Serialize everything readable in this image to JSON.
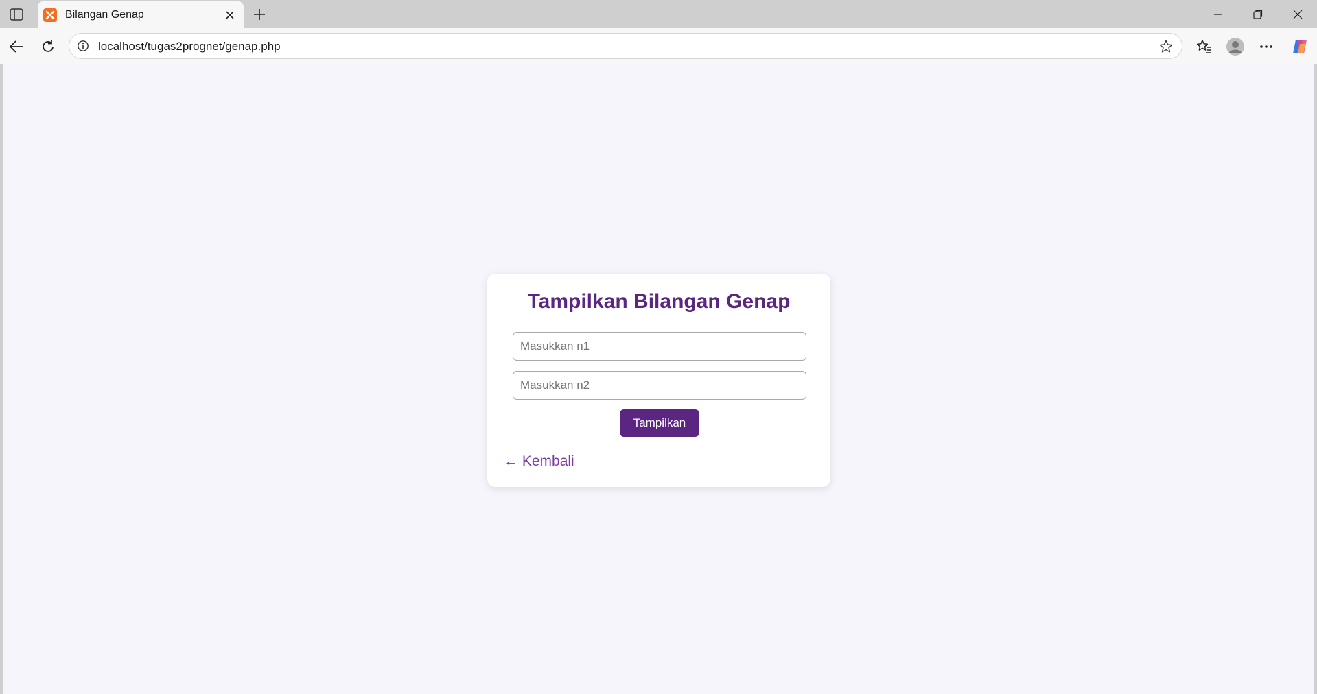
{
  "browser": {
    "tab_title": "Bilangan Genap",
    "url": "localhost/tugas2prognet/genap.php",
    "icons": {
      "sidebar": "sidebar-toggle-icon",
      "favicon": "xampp-icon",
      "tab_close": "close-icon",
      "new_tab": "plus-icon",
      "back": "arrow-left-icon",
      "reload": "reload-icon",
      "site_info": "info-icon",
      "favorite": "star-icon",
      "favorites": "favorites-icon",
      "profile": "profile-icon",
      "more": "more-icon",
      "copilot": "copilot-icon",
      "minimize": "minimize-icon",
      "restore": "restore-icon",
      "close_window": "close-icon"
    }
  },
  "page": {
    "heading": "Tampilkan Bilangan Genap",
    "n1": {
      "value": "",
      "placeholder": "Masukkan n1"
    },
    "n2": {
      "value": "",
      "placeholder": "Masukkan n2"
    },
    "submit_label": "Tampilkan",
    "back_link": "← Kembali"
  },
  "colors": {
    "accent": "#5b2682",
    "link": "#7b38a5",
    "page_background": "#f5f5fb"
  }
}
